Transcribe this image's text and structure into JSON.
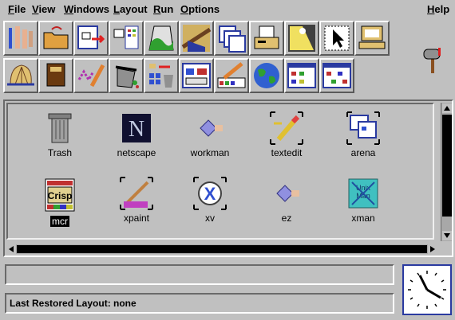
{
  "menu": {
    "file": "File",
    "view": "View",
    "windows": "Windows",
    "layout": "Layout",
    "run": "Run",
    "options": "Options",
    "help": "Help"
  },
  "toolbar": {
    "row1": [
      "tools-icon",
      "folder-open-icon",
      "window-arrow-icon",
      "app-list-icon",
      "map-icon",
      "painting-icon",
      "multiple-windows-icon",
      "printer-icon",
      "lamp-icon",
      "cursor-icon",
      "terminal-icon"
    ],
    "row2": [
      "seashell-icon",
      "book-icon",
      "pencil-draw-icon",
      "trash-recycle-icon",
      "keys-icon",
      "layout-editor-icon",
      "palette-pencil-icon",
      "globe-icon",
      "desktop-panel-icon",
      "workspace-icon"
    ]
  },
  "desktop": {
    "icons": [
      {
        "name": "trash-icon",
        "label": "Trash"
      },
      {
        "name": "netscape-icon",
        "label": "netscape"
      },
      {
        "name": "workman-icon",
        "label": "workman"
      },
      {
        "name": "textedit-icon",
        "label": "textedit"
      },
      {
        "name": "arena-icon",
        "label": "arena"
      },
      {
        "name": "mcr-icon",
        "label": "mcr",
        "badge": "Crisp"
      },
      {
        "name": "xpaint-icon",
        "label": "xpaint"
      },
      {
        "name": "xv-icon",
        "label": "xv"
      },
      {
        "name": "ez-icon",
        "label": "ez"
      },
      {
        "name": "xman-icon",
        "label": "xman",
        "badge": "Unix Man"
      }
    ]
  },
  "status": {
    "message": "",
    "layout": "Last Restored Layout: none"
  },
  "colors": {
    "background": "#c0c0c0",
    "window_blue": "#2a3aa0",
    "selection": "#000000"
  }
}
